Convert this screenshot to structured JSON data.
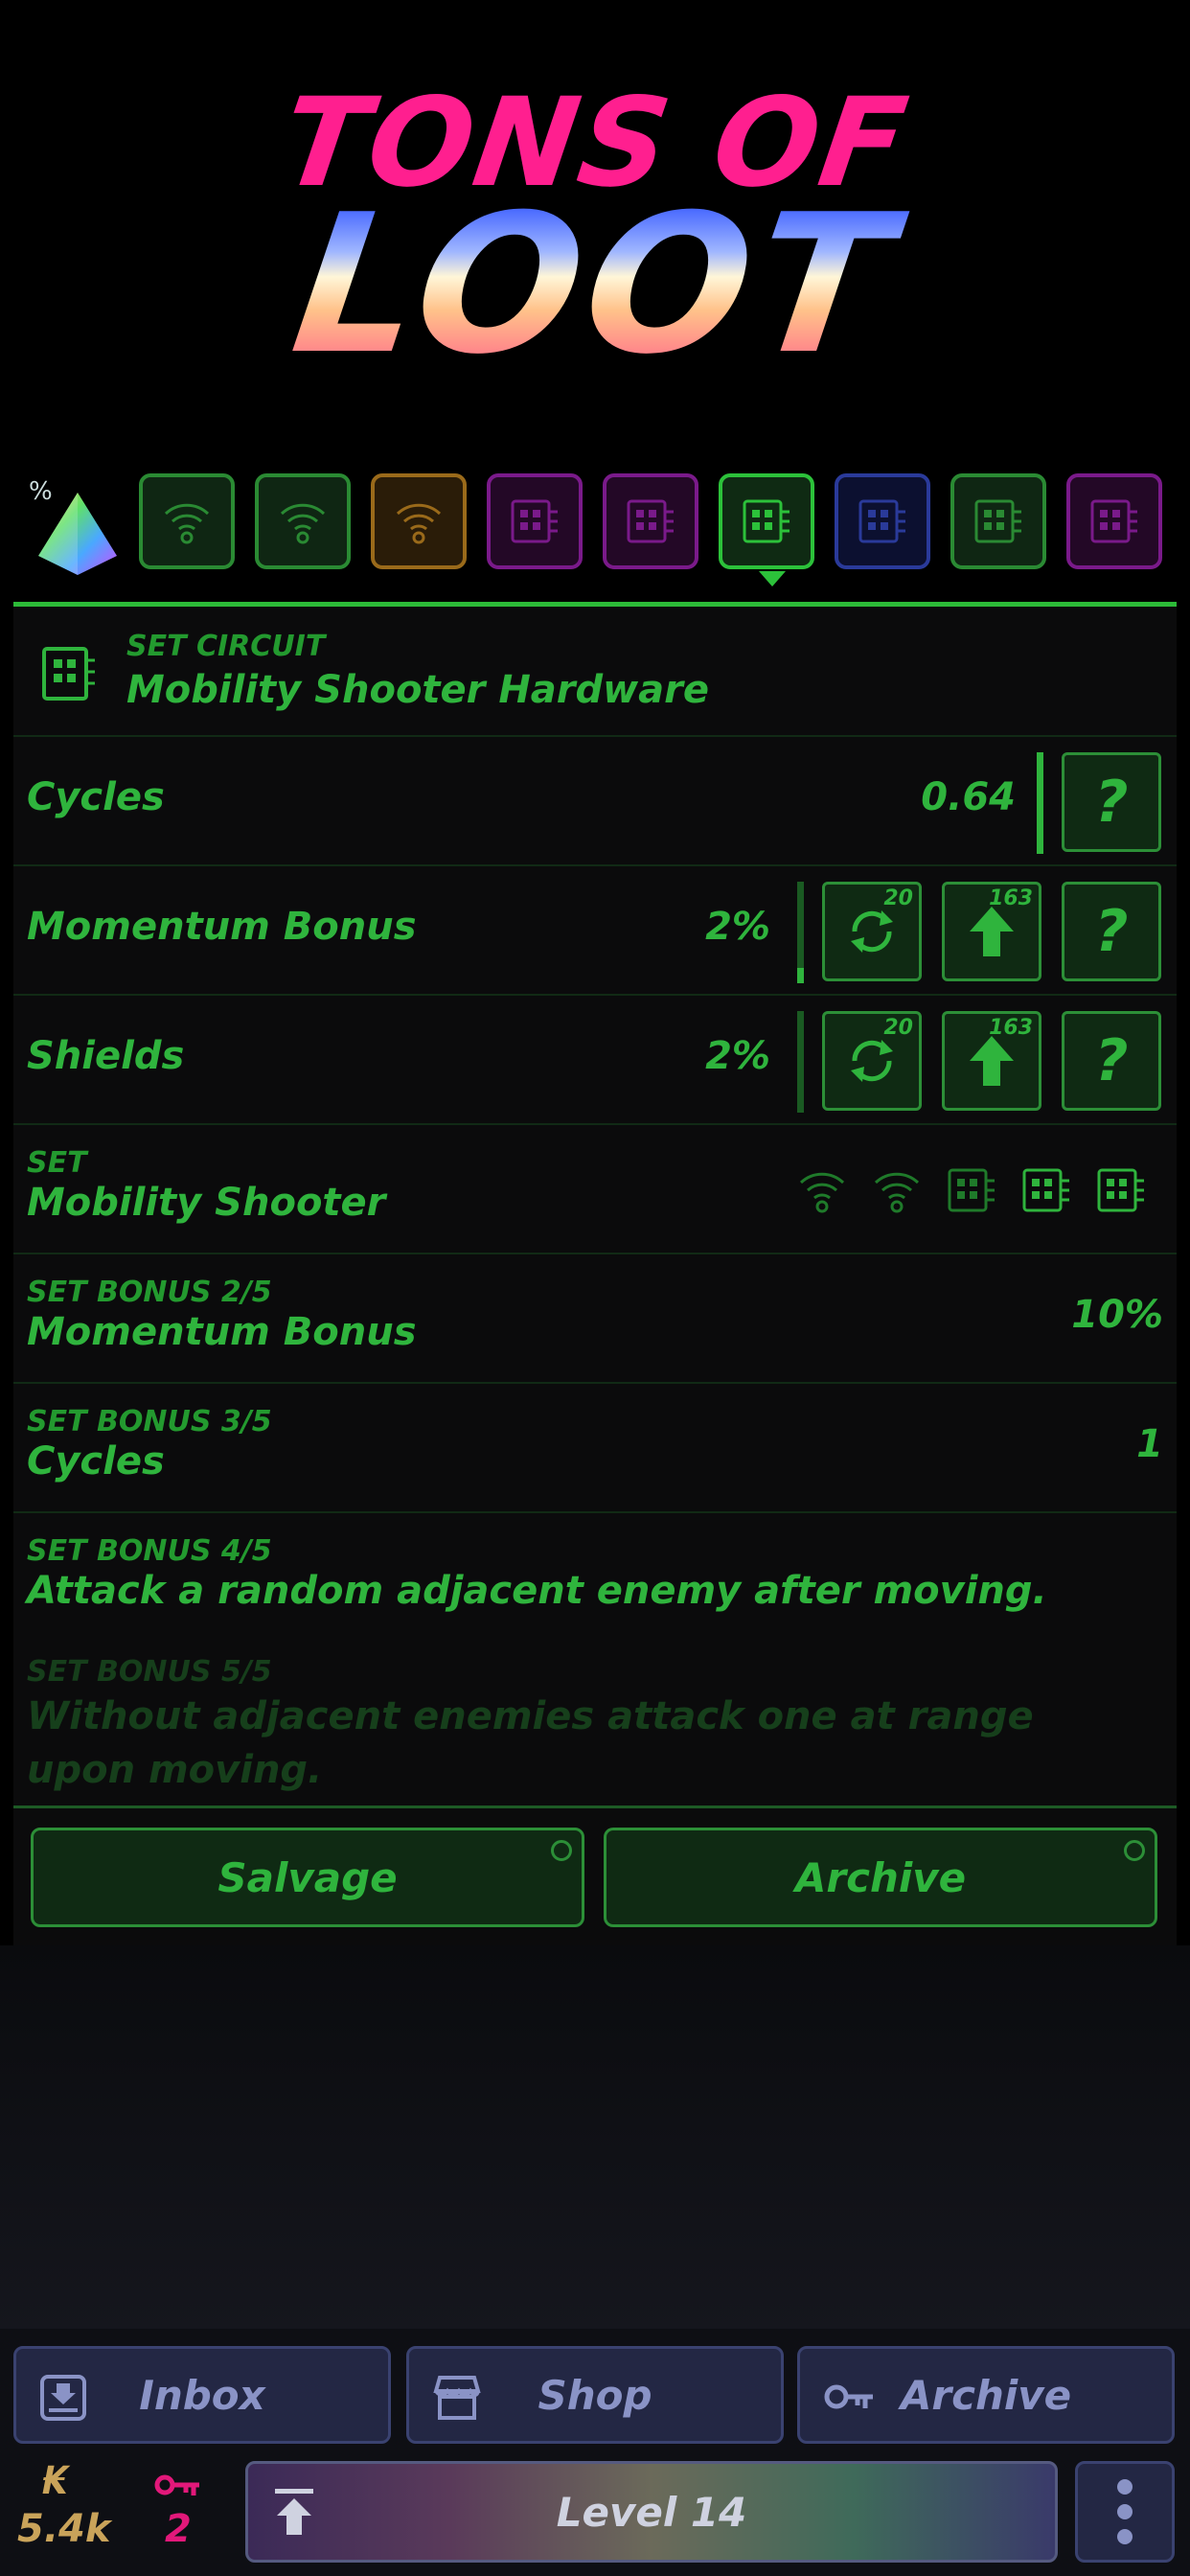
{
  "logo": {
    "line1": "TONS OF",
    "line2": "LOOT"
  },
  "itembar": {
    "percent_symbol": "%",
    "slots": [
      {
        "icon": "wifi-icon",
        "color": "#2a8a33",
        "bg": "#0f2613"
      },
      {
        "icon": "wifi-icon",
        "color": "#2a8a33",
        "bg": "#0f2613"
      },
      {
        "icon": "wifi-icon",
        "color": "#9a6a1a",
        "bg": "#2a1c08"
      },
      {
        "icon": "chip-icon",
        "color": "#7a1a8a",
        "bg": "#230826"
      },
      {
        "icon": "chip-icon",
        "color": "#7a1a8a",
        "bg": "#230826"
      },
      {
        "icon": "chip-icon",
        "color": "#2cc13a",
        "bg": "#0f2a13"
      },
      {
        "icon": "chip-icon",
        "color": "#2a3a9a",
        "bg": "#0c1030"
      },
      {
        "icon": "chip-icon",
        "color": "#2a8a33",
        "bg": "#0f2613"
      },
      {
        "icon": "chip-icon",
        "color": "#7a1a8a",
        "bg": "#230826"
      }
    ]
  },
  "header": {
    "type": "SET CIRCUIT",
    "name": "Mobility Shooter Hardware"
  },
  "stats": [
    {
      "label": "Cycles",
      "value": "0.64"
    },
    {
      "label": "Momentum Bonus",
      "value": "2%",
      "reroll_count": "20",
      "upgrade_count": "163"
    },
    {
      "label": "Shields",
      "value": "2%",
      "reroll_count": "20",
      "upgrade_count": "163"
    }
  ],
  "help_label": "?",
  "set": {
    "tag": "SET",
    "name": "Mobility Shooter"
  },
  "bonuses": [
    {
      "tag": "SET BONUS 2/5",
      "text": "Momentum Bonus",
      "value": "10%"
    },
    {
      "tag": "SET BONUS 3/5",
      "text": "Cycles",
      "value": "1"
    },
    {
      "tag": "SET BONUS 4/5",
      "text": "Attack a random adjacent enemy after moving."
    },
    {
      "tag": "SET BONUS 5/5",
      "text": "Without adjacent enemies attack one at range upon moving."
    }
  ],
  "actions": {
    "salvage": "Salvage",
    "archive": "Archive"
  },
  "nav": {
    "inbox": "Inbox",
    "shop": "Shop",
    "archive": "Archive"
  },
  "resources": {
    "currency_symbol": "₭",
    "currency": "5.4k",
    "keys": "2"
  },
  "level": {
    "label": "Level 14"
  },
  "colors": {
    "accent": "#2fb43d",
    "nav": "#8a93c6"
  }
}
